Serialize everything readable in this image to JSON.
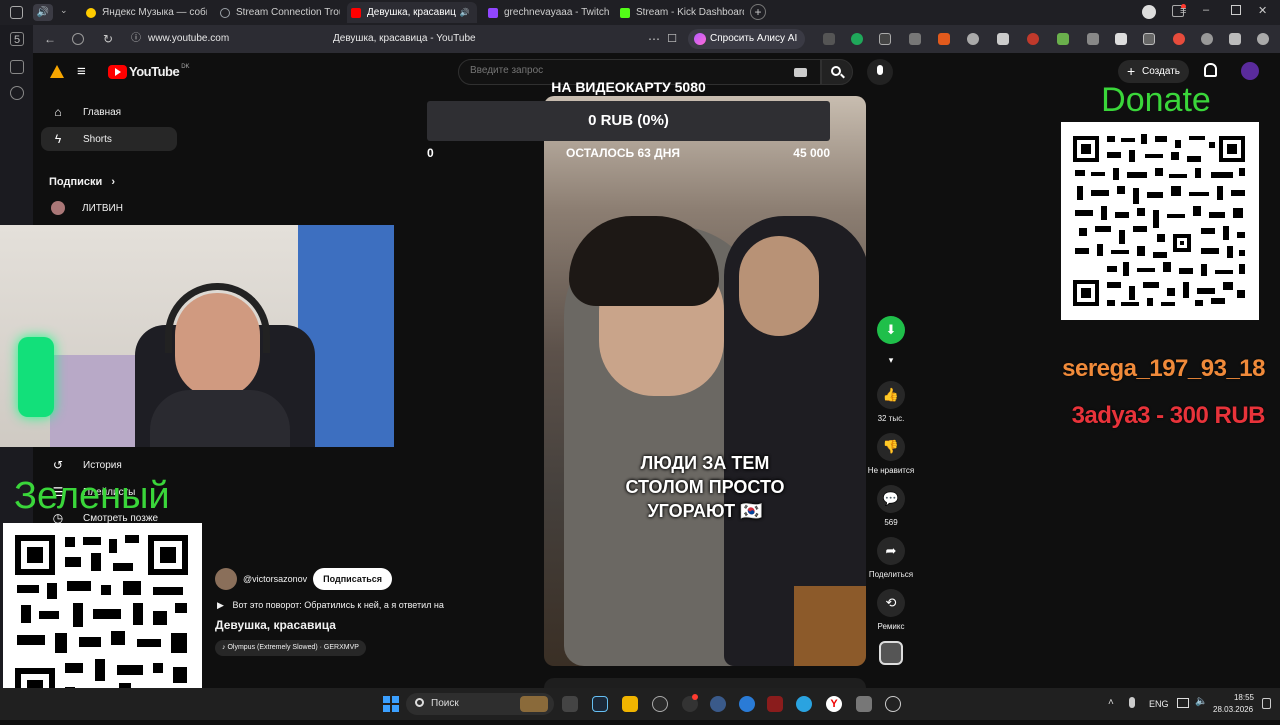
{
  "browser": {
    "tabs": [
      {
        "title": "Яндекс Музыка — собир",
        "active": false,
        "favicon_color": "#ffcc00"
      },
      {
        "title": "Stream Connection Troubl",
        "active": false,
        "favicon_color": "#9aa0a6"
      },
      {
        "title": "Девушка, красавиц",
        "active": true,
        "favicon_color": "#ff0000"
      },
      {
        "title": "grechnevayaaa - Twitch",
        "active": false,
        "favicon_color": "#9146ff"
      },
      {
        "title": "Stream - Kick Dashboard",
        "active": false,
        "favicon_color": "#53fc18"
      }
    ],
    "url": "www.youtube.com",
    "page_title": "Девушка, красавица - YouTube",
    "alice_button": "Спросить Алису AI",
    "left_strip_badge": "5"
  },
  "youtube": {
    "logo_text": "YouTube",
    "logo_region": "DK",
    "search_placeholder": "Введите запрос",
    "create_button": "Создать",
    "sidebar": {
      "items": [
        {
          "label": "Главная",
          "icon": "home-icon"
        },
        {
          "label": "Shorts",
          "icon": "shorts-icon"
        }
      ],
      "subscriptions_heading": "Подписки",
      "subscription_channel": "ЛИТВИН",
      "history": "История",
      "playlists": "Плейлисты",
      "watch_later": "Смотреть позже"
    },
    "short": {
      "channel": "@victorsazonov",
      "subscribe": "Подписаться",
      "description": "Вот это поворот: Обратились к ней, а я ответил на",
      "title": "Девушка, красавица",
      "music": "Olympus (Extremely Slowed) · GERXMVP",
      "caption_lines": [
        "ЛЮДИ ЗА ТЕМ",
        "СТОЛОМ ПРОСТО",
        "УГОРАЮТ 🇰🇷"
      ]
    },
    "actions": {
      "like_count": "32 тыс.",
      "dislike_label": "Не нравится",
      "comments_count": "569",
      "share_label": "Поделиться",
      "remix_label": "Ремикс"
    }
  },
  "stream_overlay": {
    "goal_title": "НА ВИДЕОКАРТУ 5080",
    "goal_amount": "0 RUB (0%)",
    "goal_min": "0",
    "goal_days_left": "ОСТАЛОСЬ 63 ДНЯ",
    "goal_max": "45 000",
    "goal_progress_fraction": 0,
    "donate_heading": "Donate",
    "left_qr_heading": "Зеленый",
    "last_follower": "serega_197_93_18",
    "last_donation": "3adya3 - 300 RUB"
  },
  "taskbar": {
    "search_placeholder": "Поиск",
    "language": "ENG",
    "time": "18:55",
    "date": "28.03.2026"
  },
  "colors": {
    "yt_red": "#ff0000",
    "donate_green": "#3ad63a",
    "follower_orange": "#f08a3a",
    "donation_red": "#e8333a",
    "goal_bar_bg": "#2f2f33"
  }
}
